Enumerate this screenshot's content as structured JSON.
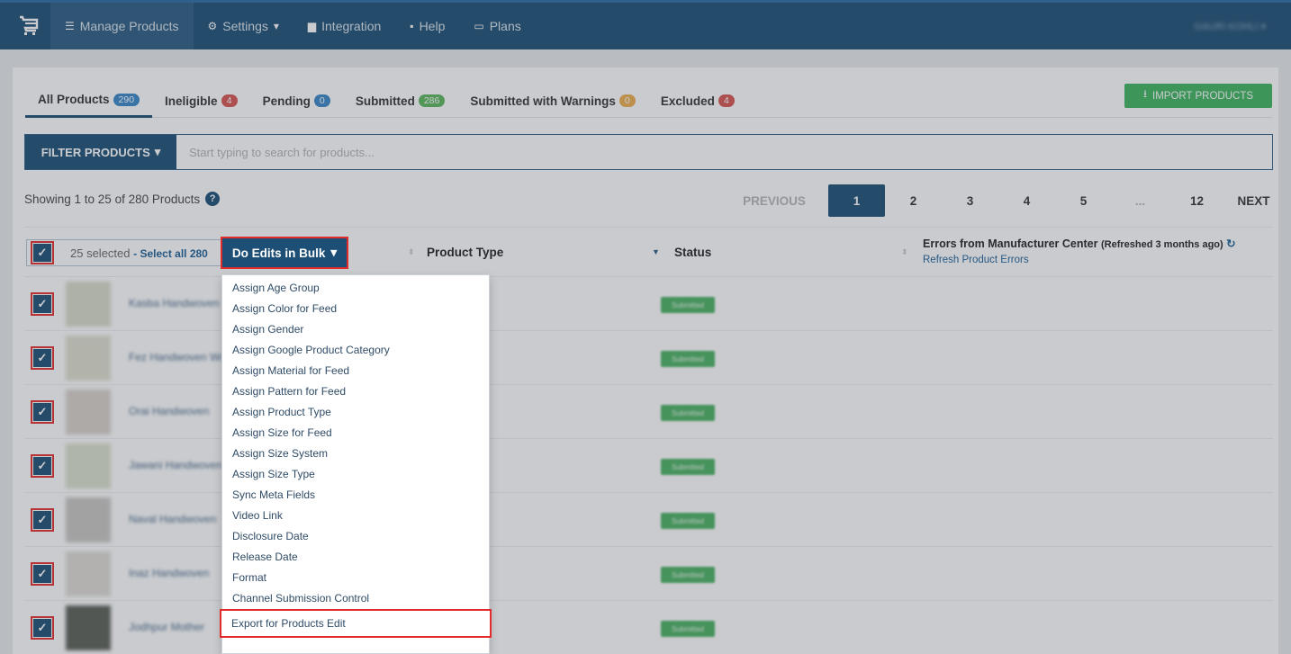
{
  "nav": {
    "items": [
      {
        "label": "Manage Products",
        "icon": "list-icon"
      },
      {
        "label": "Settings",
        "icon": "gear-icon"
      },
      {
        "label": "Integration",
        "icon": "briefcase-icon"
      },
      {
        "label": "Help",
        "icon": "help-chat-icon"
      },
      {
        "label": "Plans",
        "icon": "card-icon"
      }
    ],
    "user": "GAURI KOHLI"
  },
  "tabs": [
    {
      "label": "All Products",
      "count": "290",
      "color": "#3a87c9"
    },
    {
      "label": "Ineligible",
      "count": "4",
      "color": "#d9534f"
    },
    {
      "label": "Pending",
      "count": "0",
      "color": "#3a87c9"
    },
    {
      "label": "Submitted",
      "count": "286",
      "color": "#5cb85c"
    },
    {
      "label": "Submitted with Warnings",
      "count": "0",
      "color": "#f0ad4e"
    },
    {
      "label": "Excluded",
      "count": "4",
      "color": "#d9534f"
    }
  ],
  "import_button": "IMPORT PRODUCTS",
  "filter": {
    "button": "FILTER PRODUCTS",
    "placeholder": "Start typing to search for products..."
  },
  "showing": "Showing 1 to 25 of 280 Products",
  "pager": {
    "previous": "PREVIOUS",
    "pages": [
      "1",
      "2",
      "3",
      "4",
      "5",
      "...",
      "12"
    ],
    "next": "NEXT",
    "current": "1"
  },
  "table": {
    "selected": "25 selected",
    "select_all": "Select all 280",
    "bulk_button": "Do Edits in Bulk",
    "col_product_type": "Product Type",
    "col_status": "Status",
    "col_errors": "Errors from Manufacturer Center",
    "col_errors_note": "(Refreshed 3 months ago)",
    "refresh_link": "Refresh Product Errors"
  },
  "rows": [
    {
      "name": "Kasba Handwoven",
      "status": "Submitted"
    },
    {
      "name": "Fez Handwoven Wool",
      "status": "Submitted"
    },
    {
      "name": "Orai Handwoven",
      "status": "Submitted"
    },
    {
      "name": "Jawani Handwoven",
      "status": "Submitted"
    },
    {
      "name": "Naval Handwoven",
      "status": "Submitted"
    },
    {
      "name": "Inaz Handwoven",
      "status": "Submitted"
    },
    {
      "name": "Jodhpur Mother",
      "status": "Submitted"
    }
  ],
  "bulk_menu": [
    "Assign Age Group",
    "Assign Color for Feed",
    "Assign Gender",
    "Assign Google Product Category",
    "Assign Material for Feed",
    "Assign Pattern for Feed",
    "Assign Product Type",
    "Assign Size for Feed",
    "Assign Size System",
    "Assign Size Type",
    "Sync Meta Fields",
    "Video Link",
    "Disclosure Date",
    "Release Date",
    "Format",
    "Channel Submission Control"
  ],
  "bulk_menu_highlight": "Export for Products Edit"
}
